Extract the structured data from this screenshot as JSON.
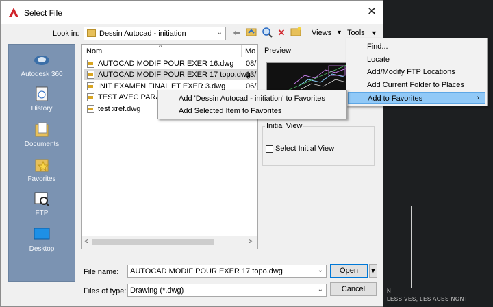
{
  "dialog": {
    "title": "Select File",
    "close_glyph": "✕"
  },
  "toolbar": {
    "look_in_label": "Look in:",
    "look_in_value": "Dessin Autocad - initiation",
    "views_label": "Views",
    "tools_label": "Tools"
  },
  "places": [
    {
      "label": "Autodesk 360",
      "icon": "cloud-icon"
    },
    {
      "label": "History",
      "icon": "history-icon"
    },
    {
      "label": "Documents",
      "icon": "documents-icon"
    },
    {
      "label": "Favorites",
      "icon": "favorites-icon"
    },
    {
      "label": "FTP",
      "icon": "ftp-icon"
    },
    {
      "label": "Desktop",
      "icon": "desktop-icon"
    }
  ],
  "filelist": {
    "columns": [
      "Nom",
      "Mo"
    ],
    "files": [
      {
        "name": "AUTOCAD MODIF POUR EXER 16.dwg",
        "date": "08/("
      },
      {
        "name": "AUTOCAD MODIF POUR EXER 17 topo.dwg",
        "date": "13/("
      },
      {
        "name": "INIT EXAMEN FINAL ET EXER 3.dwg",
        "date": "06/("
      },
      {
        "name": "TEST AVEC PARAMI",
        "date": ""
      },
      {
        "name": "test xref.dwg",
        "date": ""
      }
    ]
  },
  "preview": {
    "label": "Preview",
    "initial_view_title": "Initial View",
    "select_initial_view": "Select Initial View"
  },
  "bottom": {
    "file_name_label": "File name:",
    "file_name_value": "AUTOCAD MODIF POUR EXER 17 topo.dwg",
    "file_type_label": "Files of type:",
    "file_type_value": "Drawing (*.dwg)",
    "open_label": "Open",
    "cancel_label": "Cancel"
  },
  "tools_menu": {
    "items": [
      {
        "label": "Find..."
      },
      {
        "label": "Locate"
      },
      {
        "label": "Add/Modify FTP Locations"
      },
      {
        "label": "Add Current Folder to Places"
      },
      {
        "label": "Add to Favorites",
        "submenu_glyph": "›"
      }
    ]
  },
  "favorites_menu": {
    "items": [
      {
        "label": "Add 'Dessin Autocad - initiation' to Favorites"
      },
      {
        "label": "Add Selected Item to Favorites"
      }
    ]
  },
  "background": {
    "text_line1": "N",
    "text_line2": "LESSIVES, LES ACES NONT"
  },
  "colors": {
    "places_bar": "#7b93b2",
    "menu_highlight": "#91c9f7",
    "selected_row": "#d9d9d9"
  }
}
